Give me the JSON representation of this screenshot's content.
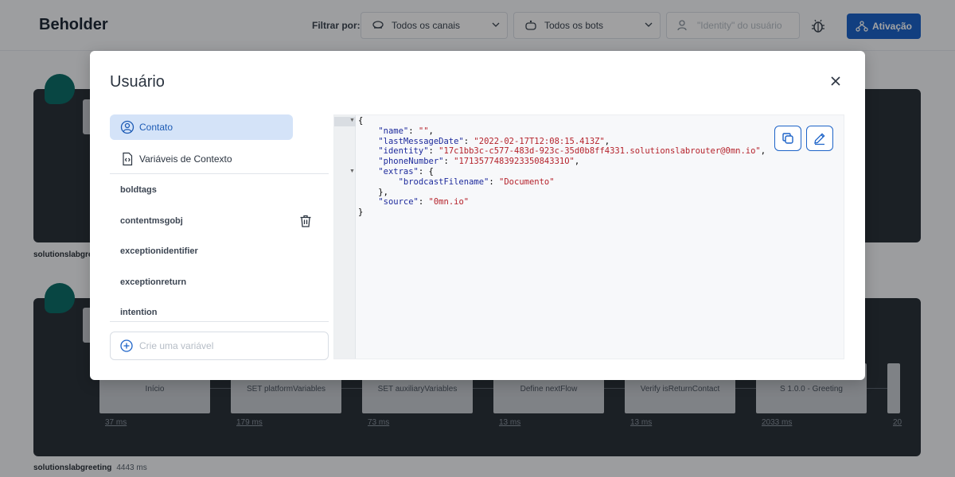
{
  "app": {
    "title": "Beholder"
  },
  "header": {
    "filter_label": "Filtrar por:",
    "channel_select": "Todos os canais",
    "bot_select": "Todos os bots",
    "identity_placeholder": "\"Identity\" do usuário",
    "activate_button": "Ativação"
  },
  "background": {
    "panel1_label": "solutionslabgree",
    "panel2_label": "solutionslabgreeting",
    "panel2_time": "4443 ms",
    "steps": [
      {
        "label": "Início",
        "time": "37 ms"
      },
      {
        "label": "SET platformVariables",
        "time": "179 ms"
      },
      {
        "label": "SET auxiliaryVariables",
        "time": "73 ms"
      },
      {
        "label": "Define nextFlow",
        "time": "13 ms"
      },
      {
        "label": "Verify isReturnContact",
        "time": "13 ms"
      },
      {
        "label": "S 1.0.0 - Greeting",
        "time": "2033 ms"
      },
      {
        "label": "",
        "time": "20"
      }
    ]
  },
  "modal": {
    "title": "Usuário",
    "tabs": [
      {
        "label": "Contato",
        "icon": "user-circle-icon",
        "active": true
      },
      {
        "label": "Variáveis de Contexto",
        "icon": "code-file-icon",
        "active": false
      }
    ],
    "variables": [
      "boldtags",
      "contentmsgobj",
      "exceptionidentifier",
      "exceptionreturn",
      "intention"
    ],
    "add_variable_placeholder": "Crie uma variável",
    "json": {
      "name": "\"\"",
      "lastMessageDate": "\"2022-02-17T12:08:15.413Z\"",
      "identity": "\"17c1bb3c-c577-483d-923c-35d0b8ff4331.solutionslabrouter@0mn.io\"",
      "phoneNumber": "\"171357748392335084331O\"",
      "brodcastFilename": "\"Documento\"",
      "source": "\"0mn.io\""
    }
  },
  "colors": {
    "primary": "#1d63c8",
    "active_tab_bg": "#d4e3f8",
    "dark_panel": "#2b323b"
  }
}
